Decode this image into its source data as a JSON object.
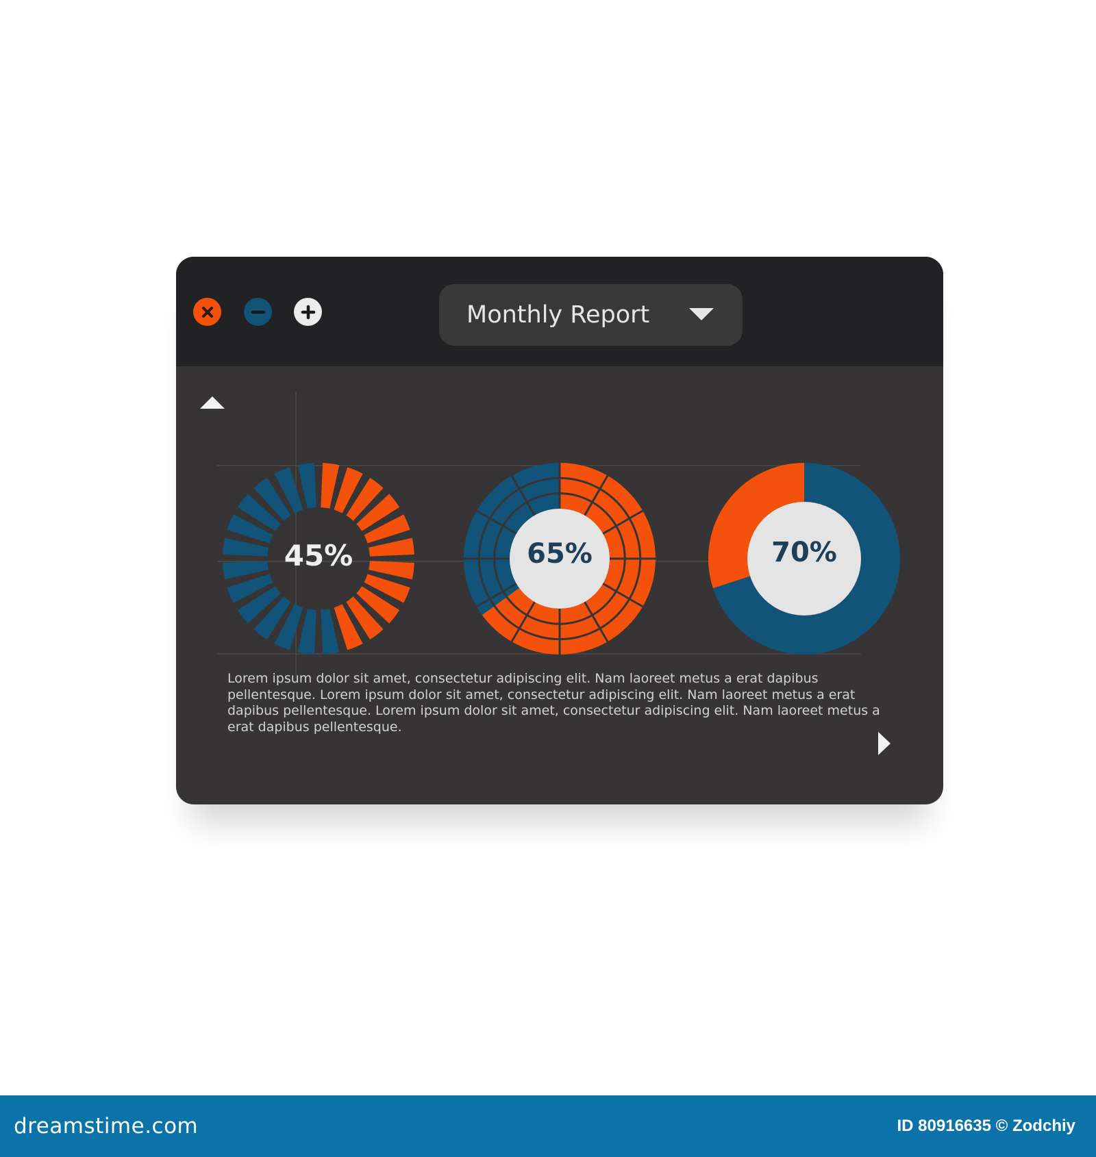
{
  "window": {
    "controls": [
      {
        "name": "close",
        "icon": "close-icon",
        "color": "#f4510d"
      },
      {
        "name": "minimize",
        "icon": "minus-icon",
        "color": "#115379"
      },
      {
        "name": "maximize",
        "icon": "plus-icon",
        "color": "#ececec"
      }
    ],
    "report_select": {
      "selected": "Monthly Report",
      "icon": "caret-down-icon"
    },
    "scroll_up_icon": "triangle-up-icon",
    "next_icon": "triangle-right-icon",
    "description": "Lorem ipsum dolor sit amet, consectetur adipiscing elit. Nam laoreet metus a erat dapibus pellentesque. Lorem ipsum dolor sit amet, consectetur adipiscing elit. Nam laoreet metus a erat dapibus pellentesque. Lorem ipsum dolor sit amet, consectetur adipiscing elit. Nam laoreet metus a erat dapibus pellentesque."
  },
  "colors": {
    "orange": "#f4510d",
    "blue": "#115379",
    "window_bg": "#363434",
    "titlebar_bg": "#222123",
    "center_disc": "#e4e4e4"
  },
  "chart_data": [
    {
      "type": "radial-segmented",
      "label": "45%",
      "value": 45,
      "segments": 24
    },
    {
      "type": "donut-segmented",
      "label": "65%",
      "value": 65,
      "rings": 3,
      "sectors": 12
    },
    {
      "type": "donut",
      "label": "70%",
      "value": 70
    }
  ],
  "footer": {
    "brand": "dreamstime.com",
    "id_text": "ID 80916635 © Zodchiy"
  }
}
